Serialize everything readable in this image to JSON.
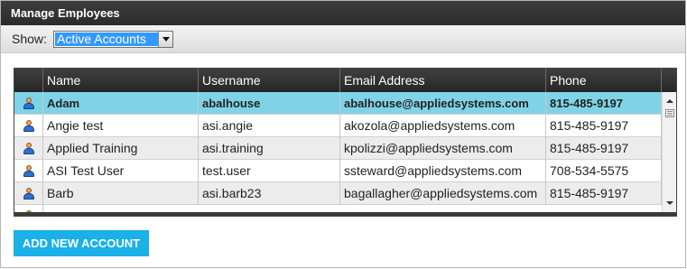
{
  "header": {
    "title": "Manage Employees"
  },
  "filter": {
    "label": "Show:",
    "selected": "Active Accounts"
  },
  "grid": {
    "columns": [
      "Name",
      "Username",
      "Email Address",
      "Phone"
    ],
    "rows": [
      {
        "name": "Adam",
        "username": "abalhouse",
        "email": "abalhouse@appliedsystems.com",
        "phone": "815-485-9197",
        "selected": true
      },
      {
        "name": "Angie test",
        "username": "asi.angie",
        "email": "akozola@appliedsystems.com",
        "phone": "815-485-9197"
      },
      {
        "name": "Applied Training",
        "username": "asi.training",
        "email": "kpolizzi@appliedsystems.com",
        "phone": "815-485-9197"
      },
      {
        "name": "ASI Test User",
        "username": "test.user",
        "email": "ssteward@appliedsystems.com",
        "phone": "708-534-5575"
      },
      {
        "name": "Barb",
        "username": "asi.barb23",
        "email": "bagallagher@appliedsystems.com",
        "phone": "815-485-9197"
      }
    ]
  },
  "actions": {
    "add_label": "ADD NEW ACCOUNT"
  },
  "colors": {
    "header_bg": "#2b2b2b",
    "selected_row": "#7fd3e6",
    "button_bg": "#1ab0e8",
    "dropdown_highlight": "#3399ff"
  }
}
